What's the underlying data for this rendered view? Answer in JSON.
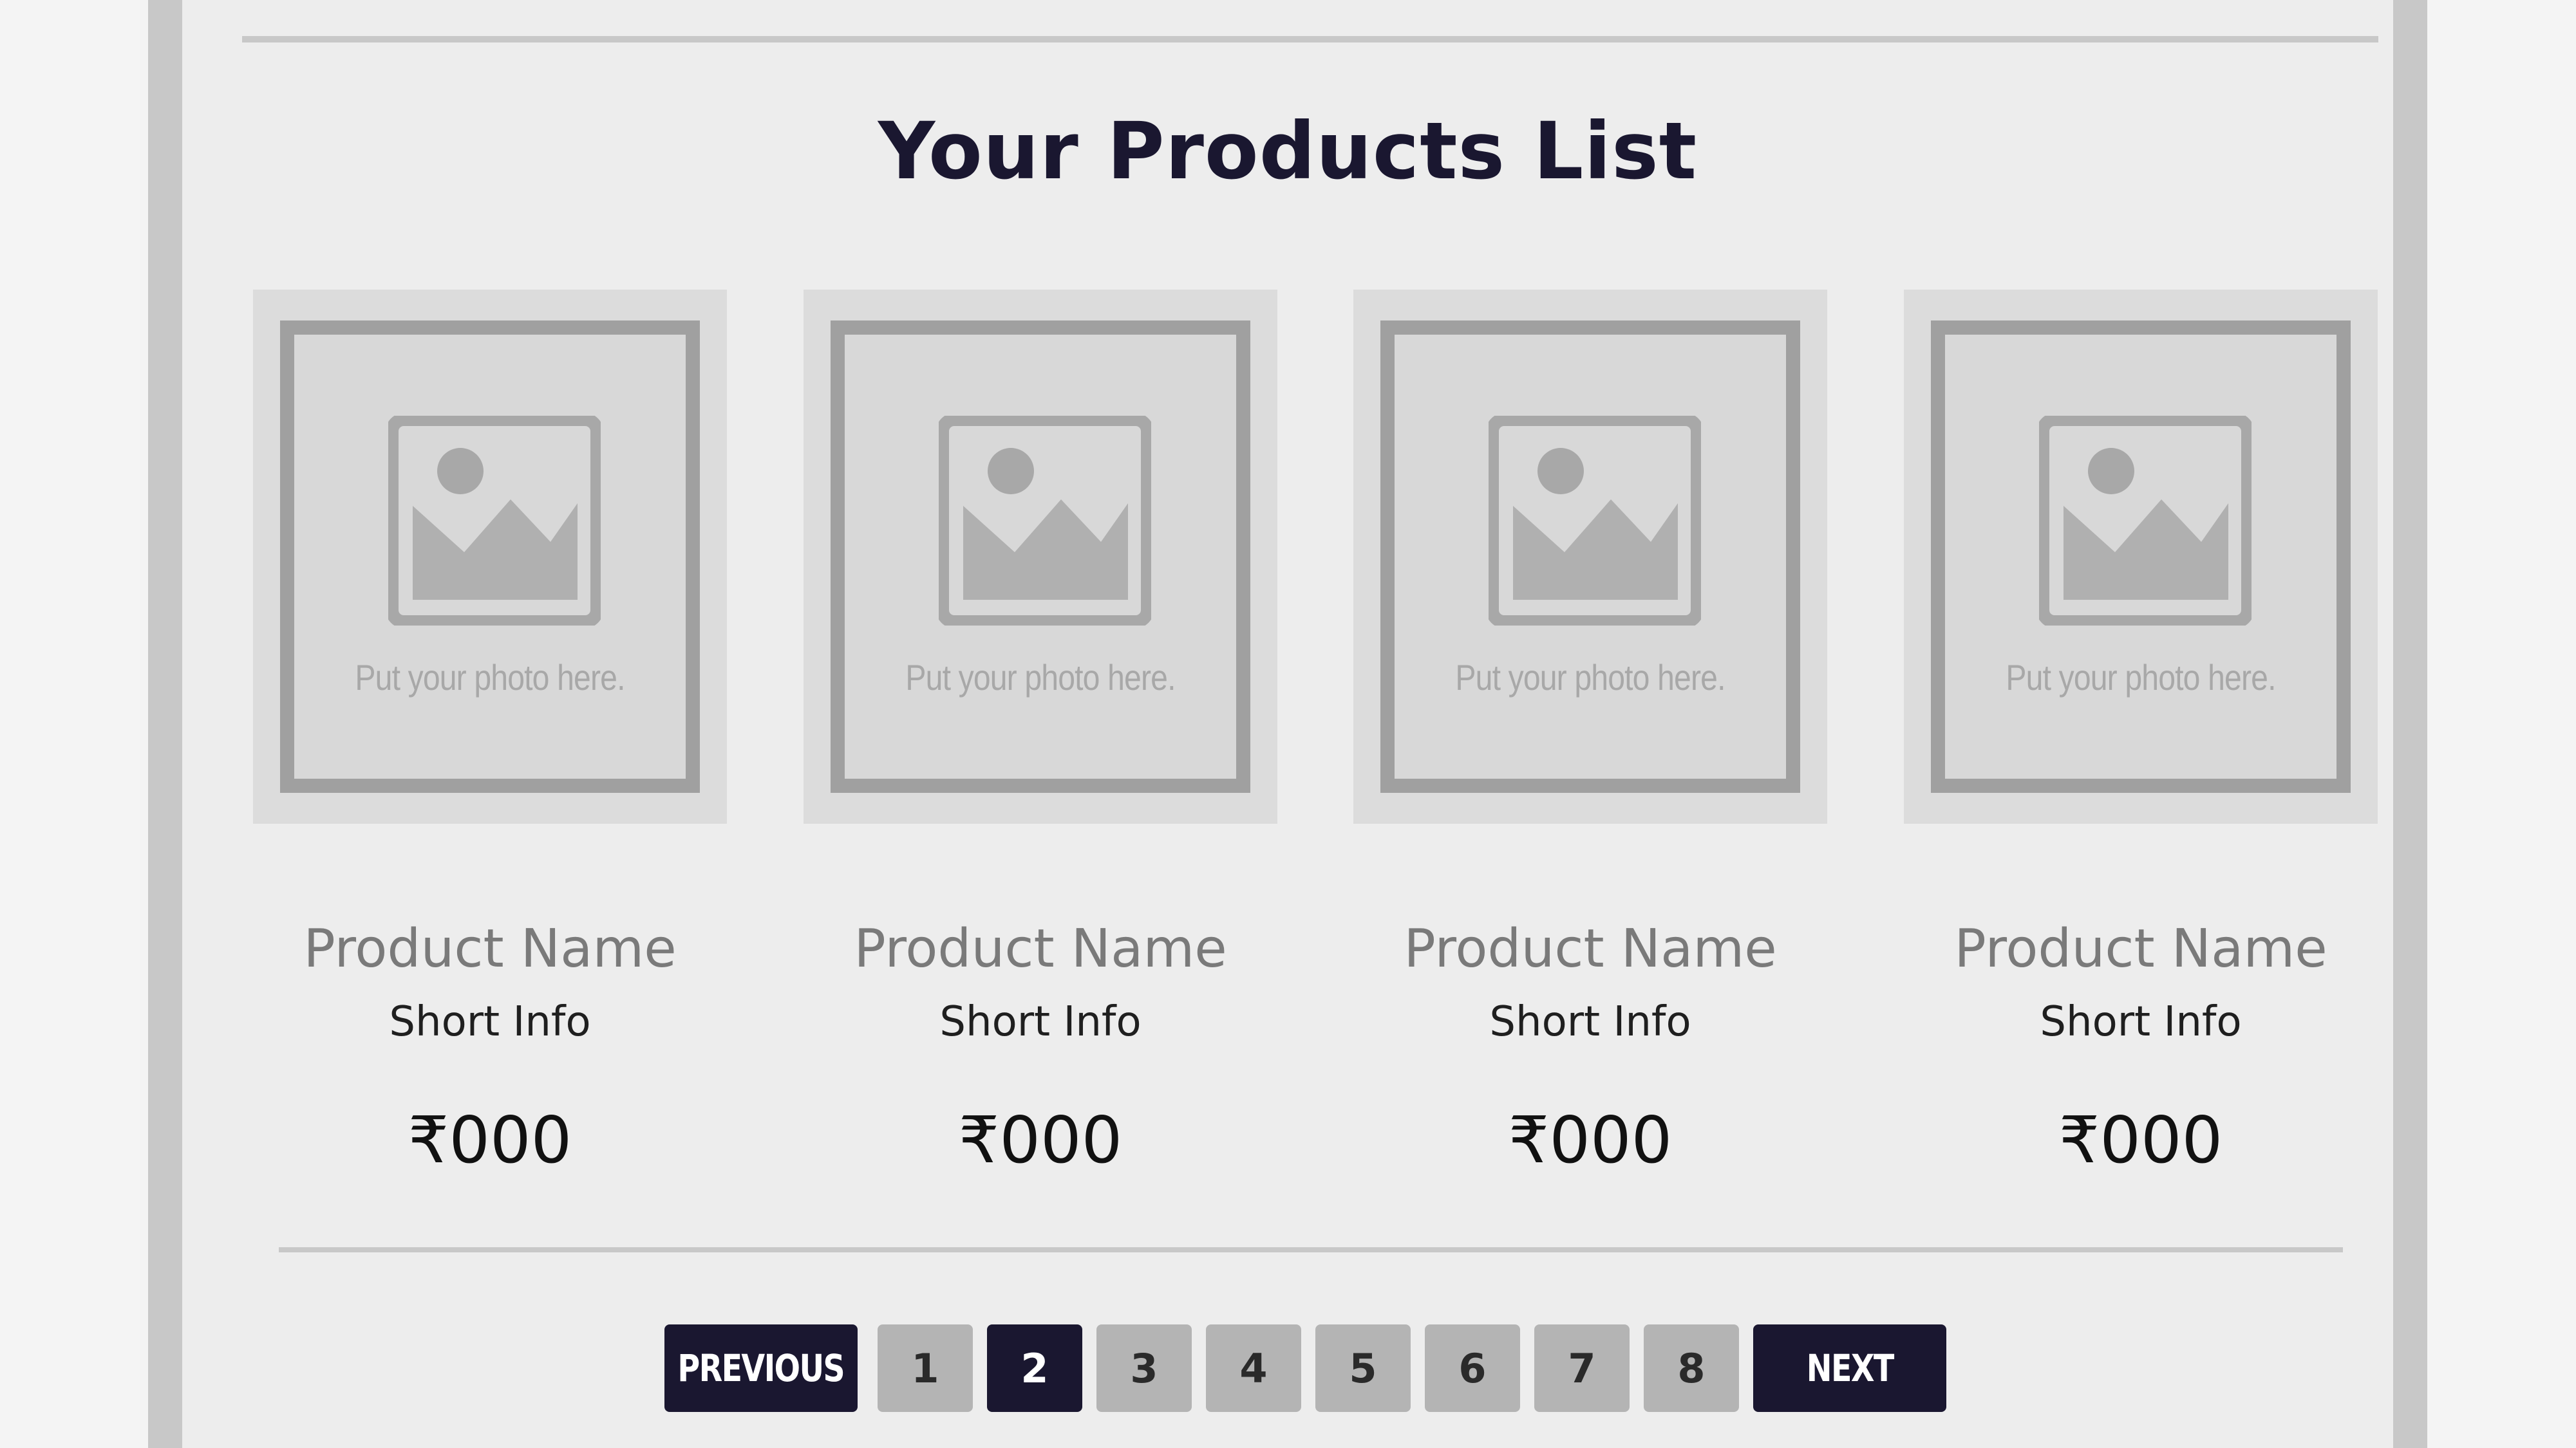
{
  "page": {
    "title": "Your Products List"
  },
  "products": [
    {
      "photo_placeholder": "Put your photo here.",
      "name": "Product Name",
      "info": "Short Info",
      "price": "₹000",
      "image_icon": "image-placeholder-icon"
    },
    {
      "photo_placeholder": "Put your photo here.",
      "name": "Product Name",
      "info": "Short Info",
      "price": "₹000",
      "image_icon": "image-placeholder-icon"
    },
    {
      "photo_placeholder": "Put your photo here.",
      "name": "Product Name",
      "info": "Short Info",
      "price": "₹000",
      "image_icon": "image-placeholder-icon"
    },
    {
      "photo_placeholder": "Put your photo here.",
      "name": "Product Name",
      "info": "Short Info",
      "price": "₹000",
      "image_icon": "image-placeholder-icon"
    }
  ],
  "pagination": {
    "previous_label": "PREVIOUS",
    "next_label": "NEXT",
    "pages": [
      "1",
      "2",
      "3",
      "4",
      "5",
      "6",
      "7",
      "8"
    ],
    "current_page": "2"
  },
  "colors": {
    "accent_dark": "#1a1730",
    "inactive_page": "#b4b4b4",
    "panel_background": "#ededed",
    "frame_border": "#c8c8c8"
  }
}
